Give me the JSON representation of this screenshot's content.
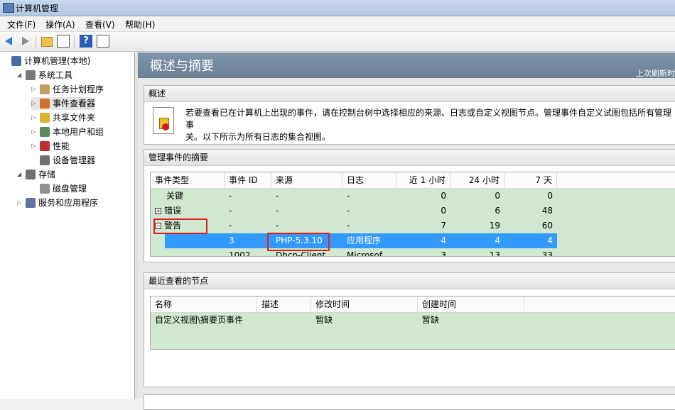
{
  "window": {
    "title": "计算机管理"
  },
  "menu": [
    "文件(F)",
    "操作(A)",
    "查看(V)",
    "帮助(H)"
  ],
  "tree": [
    {
      "label": "计算机管理(本地)",
      "level": 0,
      "expander": "",
      "icon_color": "#4a6fa8"
    },
    {
      "label": "系统工具",
      "level": 1,
      "expander": "◢",
      "icon_color": "#7a7a7a"
    },
    {
      "label": "任务计划程序",
      "level": 2,
      "expander": "▷",
      "icon_color": "#c0a060"
    },
    {
      "label": "事件查看器",
      "level": 2,
      "expander": "▷",
      "icon_color": "#d07030"
    },
    {
      "label": "共享文件夹",
      "level": 2,
      "expander": "▷",
      "icon_color": "#e0b030"
    },
    {
      "label": "本地用户和组",
      "level": 2,
      "expander": "▷",
      "icon_color": "#5a8a5a"
    },
    {
      "label": "性能",
      "level": 2,
      "expander": "▷",
      "icon_color": "#c03030"
    },
    {
      "label": "设备管理器",
      "level": 2,
      "expander": "",
      "icon_color": "#707070"
    },
    {
      "label": "存储",
      "level": 1,
      "expander": "◢",
      "icon_color": "#707070"
    },
    {
      "label": "磁盘管理",
      "level": 2,
      "expander": "",
      "icon_color": "#909090"
    },
    {
      "label": "服务和应用程序",
      "level": 1,
      "expander": "▷",
      "icon_color": "#6070a0"
    }
  ],
  "header": {
    "title": "概述与摘要",
    "right_text": "上次刷新时"
  },
  "overview": {
    "title": "概述",
    "text": "若要查看已在计算机上出现的事件，请在控制台树中选择相应的来源、日志或自定义视图节点。管理事件自定义试图包括所有管理事件，而不管其来源。以下所示为所有日志的集合视图。",
    "line1": "若要查看已在计算机上出现的事件，请在控制台树中选择相应的来源、日志或自定义视图节点。管理事件自定义试图包括所有管理事",
    "line2": "关。以下所示为所有日志的集合视图。"
  },
  "summary": {
    "title": "管理事件的摘要",
    "columns": [
      "事件类型",
      "事件 ID",
      "来源",
      "日志",
      "近 1 小时",
      "24 小时",
      "7 天"
    ],
    "rows": [
      {
        "type": "关键",
        "id": "-",
        "source": "-",
        "log": "-",
        "h1": "0",
        "h24": "0",
        "d7": "0",
        "expander": ""
      },
      {
        "type": "错误",
        "id": "-",
        "source": "-",
        "log": "-",
        "h1": "0",
        "h24": "6",
        "d7": "48",
        "expander": "+"
      },
      {
        "type": "警告",
        "id": "-",
        "source": "-",
        "log": "-",
        "h1": "7",
        "h24": "19",
        "d7": "60",
        "expander": "−"
      },
      {
        "type": "",
        "id": "3",
        "source": "PHP-5.3.10",
        "log": "应用程序",
        "h1": "4",
        "h24": "4",
        "d7": "4",
        "expander": ""
      },
      {
        "type": "",
        "id": "1002",
        "source": "Dhcp-Client",
        "log": "Microsof",
        "h1": "3",
        "h24": "13",
        "d7": "33",
        "expander": ""
      }
    ]
  },
  "recent": {
    "title": "最近查看的节点",
    "columns": [
      "名称",
      "描述",
      "修改时间",
      "创建时间"
    ],
    "rows": [
      {
        "name": "自定义视图\\摘要页事件",
        "desc": "",
        "modified": "暂缺",
        "created": "暂缺"
      }
    ]
  }
}
